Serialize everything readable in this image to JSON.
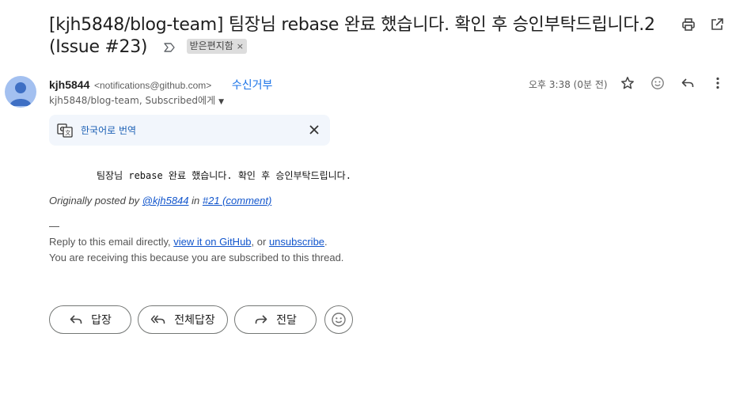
{
  "subject": {
    "text": "[kjh5848/blog-team] 팀장님 rebase 완료 했습니다. 확인 후 승인부탁드립니다.2 (Issue #23)",
    "label": "받은편지함",
    "label_remove": "×"
  },
  "sender": {
    "name": "kjh5844",
    "email": "<notifications@github.com>",
    "unsubscribe": "수신거부",
    "to": "kjh5848/blog-team, Subscribed에게",
    "time": "오후 3:38 (0분 전)"
  },
  "translate": {
    "label": "한국어로 번역"
  },
  "body": {
    "main_text": "팀장님 rebase 완료 했습니다. 확인 후 승인부탁드립니다.",
    "orig_prefix": "Originally posted by ",
    "orig_user": "@kjh5844",
    "orig_in": " in ",
    "orig_link": "#21 (comment)",
    "dash": "—",
    "footer_prefix": "Reply to this email directly, ",
    "footer_link1": "view it on GitHub",
    "footer_mid": ", or ",
    "footer_link2": "unsubscribe",
    "footer_end": ".",
    "footer2": "You are receiving this because you are subscribed to this thread."
  },
  "actions": {
    "reply": "답장",
    "reply_all": "전체답장",
    "forward": "전달"
  },
  "colors": {
    "link": "#1155cc",
    "accent": "#1a73e8",
    "translate_bg": "#f2f6fc",
    "avatar": "#a3c0f0"
  }
}
